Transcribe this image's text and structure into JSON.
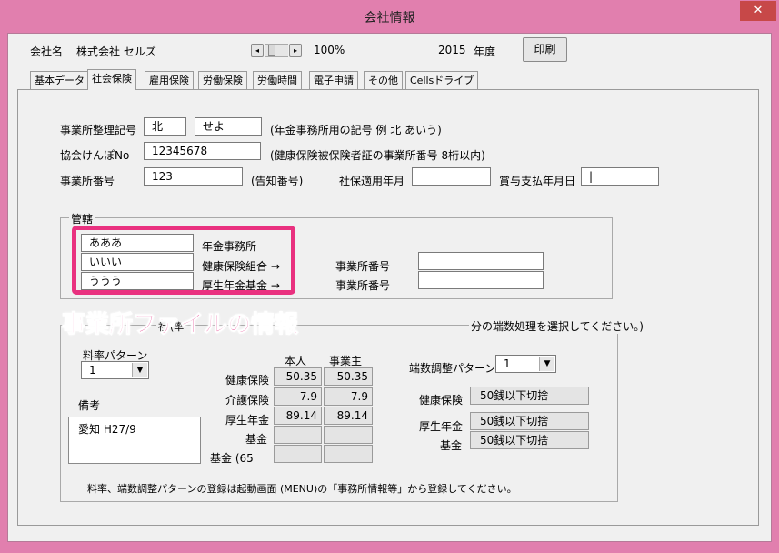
{
  "window": {
    "title": "会社情報",
    "close": "✕"
  },
  "header": {
    "company_label": "会社名",
    "company_name": "株式会社 セルズ",
    "zoom": "100%",
    "year": "2015",
    "year_label": "年度",
    "print_button": "印刷"
  },
  "tabs": [
    "基本データ",
    "社会保険",
    "雇用保険",
    "労働保険",
    "労働時間",
    "電子申請",
    "その他",
    "Cellsドライブ"
  ],
  "form": {
    "office_code_label": "事業所整理記号",
    "office_code_1": "北",
    "office_code_2": "せよ",
    "office_code_note": "(年金事務所用の記号 例 北 あいう)",
    "kyokai_label": "協会けんぽNo",
    "kyokai_value": "12345678",
    "kyokai_note": "(健康保険被保険者証の事業所番号 8桁以内)",
    "office_num_label": "事業所番号",
    "office_num_value": "123",
    "office_num_note": "(告知番号)",
    "shaho_date_label": "社保適用年月",
    "shaho_date_value": "",
    "bonus_date_label": "賞与支払年月日",
    "bonus_date_value": "|"
  },
  "jurisdiction": {
    "title": "管轄",
    "rows": [
      {
        "value": "あああ",
        "label": "年金事務所"
      },
      {
        "value": "いいい",
        "label": "健康保険組合 →"
      },
      {
        "value": "ううう",
        "label": "厚生年金基金 →"
      }
    ],
    "office_num_label_1": "事業所番号",
    "office_num_label_2": "事業所番号",
    "office_num_1": "",
    "office_num_2": ""
  },
  "overlay": {
    "text": "事業所ファイルの情報"
  },
  "rates": {
    "group_title_left": "社",
    "group_title_frag": "(率",
    "group_title_right": "分の端数処理を選択してください。)",
    "pattern_label": "料率パターン",
    "pattern_value": "1",
    "remarks_label": "備考",
    "remarks_value": "愛知 H27/9",
    "col_self": "本人",
    "col_employer": "事業主",
    "rows": [
      {
        "label": "健康保険",
        "self": "50.35",
        "employer": "50.35"
      },
      {
        "label": "介護保険",
        "self": "7.9",
        "employer": "7.9"
      },
      {
        "label": "厚生年金",
        "self": "89.14",
        "employer": "89.14"
      },
      {
        "label": "基金",
        "self": "",
        "employer": ""
      },
      {
        "label": "基金 (65",
        "self": "",
        "employer": ""
      }
    ],
    "rounding_pattern_label": "端数調整パターン",
    "rounding_pattern_value": "1",
    "rounding_rows": [
      {
        "label": "健康保険",
        "value": "50銭以下切捨"
      },
      {
        "label": "厚生年金",
        "value": "50銭以下切捨"
      },
      {
        "label": "基金",
        "value": "50銭以下切捨"
      }
    ],
    "footer_note": "料率、端数調整パターンの登録は起動画面 (MENU)の「事務所情報等」から登録してください。"
  }
}
